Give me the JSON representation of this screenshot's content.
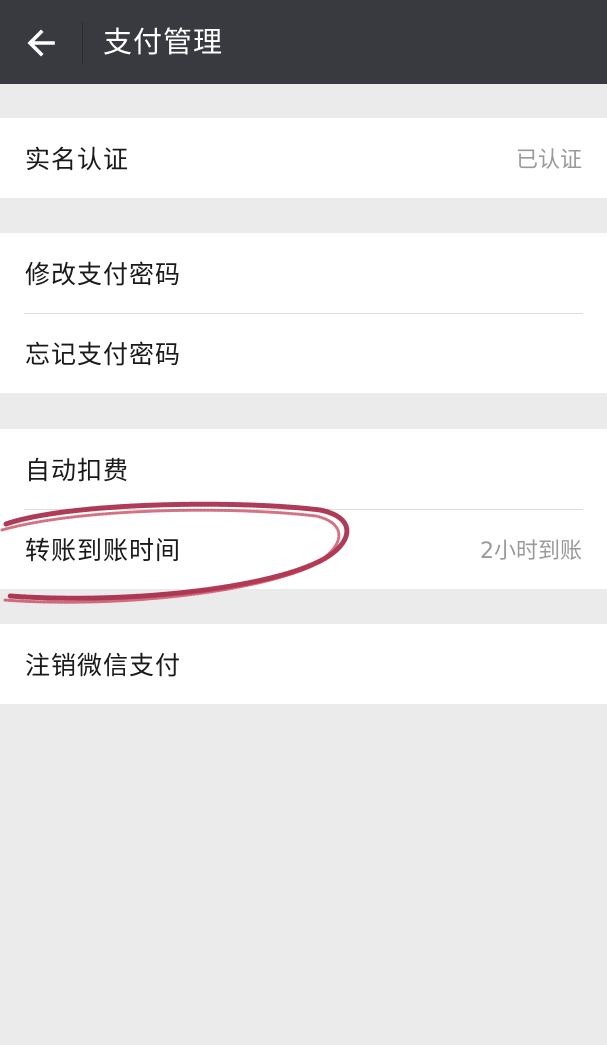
{
  "header": {
    "title": "支付管理",
    "back_icon": "arrow-left-icon",
    "background_color": "#393a3f"
  },
  "groups": [
    {
      "rows": [
        {
          "label": "实名认证",
          "value": "已认证"
        }
      ]
    },
    {
      "rows": [
        {
          "label": "修改支付密码",
          "value": ""
        },
        {
          "label": "忘记支付密码",
          "value": ""
        }
      ]
    },
    {
      "rows": [
        {
          "label": "自动扣费",
          "value": ""
        },
        {
          "label": "转账到账时间",
          "value": "2小时到账"
        }
      ]
    },
    {
      "rows": [
        {
          "label": "注销微信支付",
          "value": ""
        }
      ]
    }
  ],
  "annotation": {
    "shape": "hand-drawn-ellipse",
    "color": "#a0193a"
  }
}
